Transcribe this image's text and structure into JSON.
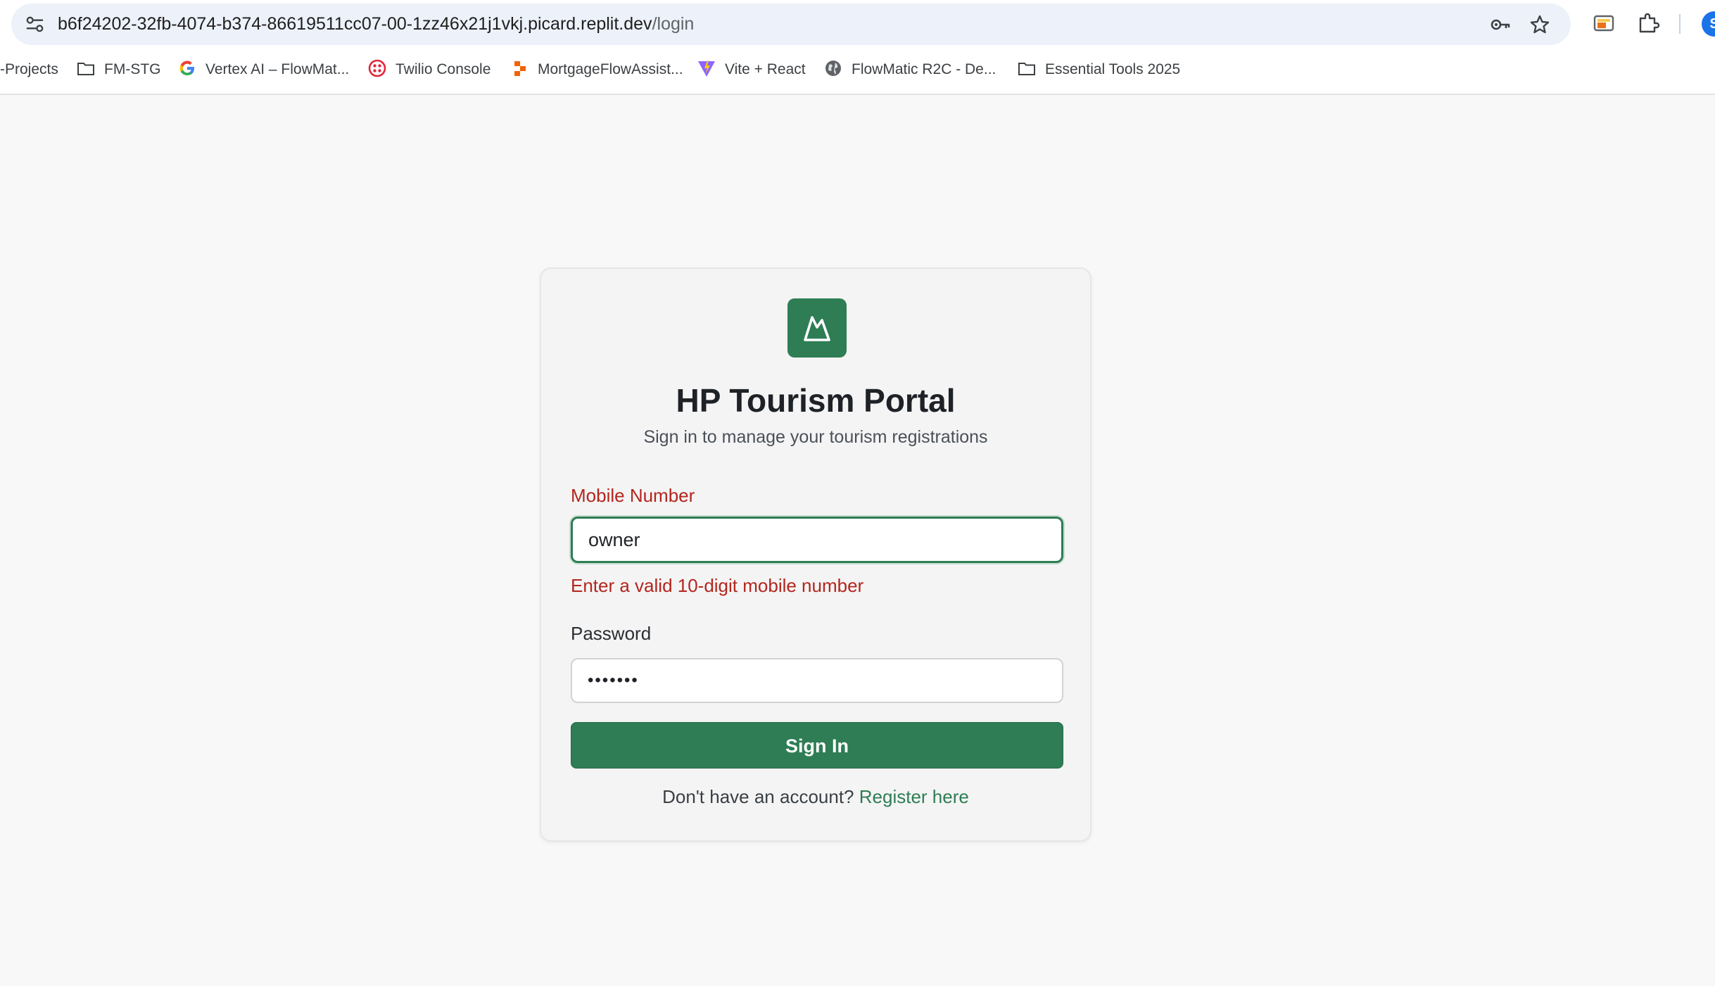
{
  "browser": {
    "url_host": "b6f24202-32fb-4074-b374-86619511cc07-00-1zz46x21j1vkj.picard.replit.dev",
    "url_path": "/login",
    "profile_initial": "S",
    "bookmarks": [
      {
        "label": "-Projects",
        "icon": "none"
      },
      {
        "label": "FM-STG",
        "icon": "folder-icon"
      },
      {
        "label": "Vertex AI – FlowMat...",
        "icon": "google-icon"
      },
      {
        "label": "Twilio Console",
        "icon": "twilio-icon"
      },
      {
        "label": "MortgageFlowAssist...",
        "icon": "replit-icon"
      },
      {
        "label": "Vite + React",
        "icon": "vite-icon"
      },
      {
        "label": "FlowMatic R2C - De...",
        "icon": "globe-icon"
      },
      {
        "label": "Essential Tools 2025",
        "icon": "folder-icon"
      }
    ]
  },
  "login": {
    "title": "HP Tourism Portal",
    "subtitle": "Sign in to manage your tourism registrations",
    "mobile_label": "Mobile Number",
    "mobile_value": "owner",
    "mobile_error": "Enter a valid 10-digit mobile number",
    "password_label": "Password",
    "password_value": "•••••••",
    "signin_label": "Sign In",
    "footer_text": "Don't have an account?",
    "register_link": "Register here"
  },
  "colors": {
    "brand": "#2e7d55",
    "error": "#b3261e",
    "page_bg": "#f8f8f8"
  }
}
